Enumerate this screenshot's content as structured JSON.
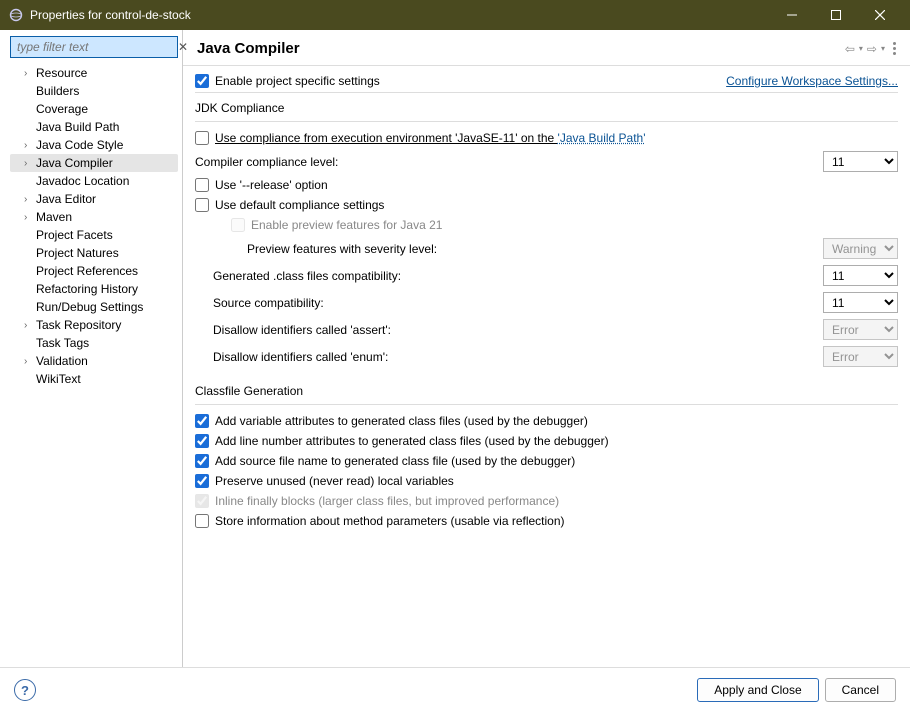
{
  "window": {
    "title": "Properties for control-de-stock"
  },
  "sidebar": {
    "filter_placeholder": "type filter text",
    "items": [
      {
        "label": "Resource",
        "expandable": true
      },
      {
        "label": "Builders"
      },
      {
        "label": "Coverage"
      },
      {
        "label": "Java Build Path"
      },
      {
        "label": "Java Code Style",
        "expandable": true
      },
      {
        "label": "Java Compiler",
        "expandable": true,
        "selected": true
      },
      {
        "label": "Javadoc Location"
      },
      {
        "label": "Java Editor",
        "expandable": true
      },
      {
        "label": "Maven",
        "expandable": true
      },
      {
        "label": "Project Facets"
      },
      {
        "label": "Project Natures"
      },
      {
        "label": "Project References"
      },
      {
        "label": "Refactoring History"
      },
      {
        "label": "Run/Debug Settings"
      },
      {
        "label": "Task Repository",
        "expandable": true
      },
      {
        "label": "Task Tags"
      },
      {
        "label": "Validation",
        "expandable": true
      },
      {
        "label": "WikiText"
      }
    ]
  },
  "header": {
    "title": "Java Compiler"
  },
  "topbar": {
    "enable_label": "Enable project specific settings",
    "configure_link": "Configure Workspace Settings..."
  },
  "jdk": {
    "group_title": "JDK Compliance",
    "use_env_prefix": "Use compliance from execution environment 'JavaSE-11' on the ",
    "use_env_link": "'Java Build Path'",
    "compliance_level_label": "Compiler compliance level:",
    "compliance_level_value": "11",
    "use_release_label": "Use '--release' option",
    "use_default_label": "Use default compliance settings",
    "enable_preview_label": "Enable preview features for Java 21",
    "preview_severity_label": "Preview features with severity level:",
    "preview_severity_value": "Warning",
    "generated_compat_label": "Generated .class files compatibility:",
    "generated_compat_value": "11",
    "source_compat_label": "Source compatibility:",
    "source_compat_value": "11",
    "disallow_assert_label": "Disallow identifiers called 'assert':",
    "disallow_assert_value": "Error",
    "disallow_enum_label": "Disallow identifiers called 'enum':",
    "disallow_enum_value": "Error"
  },
  "classfile": {
    "group_title": "Classfile Generation",
    "var_attrs": "Add variable attributes to generated class files (used by the debugger)",
    "line_numbers": "Add line number attributes to generated class files (used by the debugger)",
    "source_file": "Add source file name to generated class file (used by the debugger)",
    "preserve_unused": "Preserve unused (never read) local variables",
    "inline_finally": "Inline finally blocks (larger class files, but improved performance)",
    "store_params": "Store information about method parameters (usable via reflection)"
  },
  "footer": {
    "apply_close": "Apply and Close",
    "cancel": "Cancel"
  }
}
